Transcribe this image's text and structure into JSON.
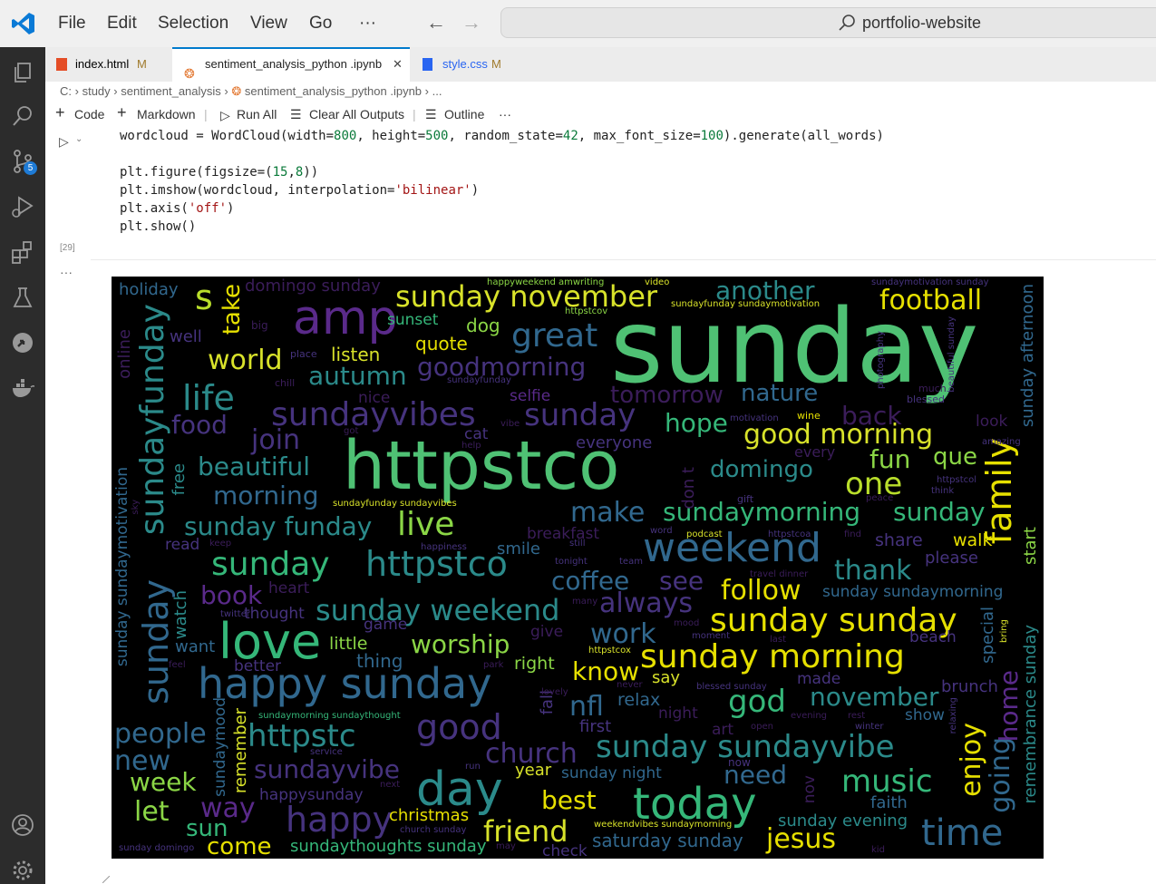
{
  "menu": {
    "file": "File",
    "edit": "Edit",
    "selection": "Selection",
    "view": "View",
    "go": "Go",
    "more": "···"
  },
  "search": {
    "text": "portfolio-website"
  },
  "activity": {
    "scm_badge": "5"
  },
  "tabs": [
    {
      "name": "index.html",
      "status": "M"
    },
    {
      "name": "sentiment_analysis_python .ipynb",
      "close": "✕"
    },
    {
      "name": "style.css",
      "status": "M"
    }
  ],
  "breadcrumb": {
    "drive": "C:",
    "folder1": "study",
    "folder2": "sentiment_analysis",
    "file": "sentiment_analysis_python .ipynb",
    "ellipsis": "..."
  },
  "toolbar": {
    "code": "Code",
    "markdown": "Markdown",
    "run_all": "Run All",
    "clear": "Clear All Outputs",
    "outline": "Outline",
    "more": "···"
  },
  "cell": {
    "exec_count": "[29]",
    "line1_a": "wordcloud = WordCloud(width=",
    "line1_n1": "800",
    "line1_b": ", height=",
    "line1_n2": "500",
    "line1_c": ", random_state=",
    "line1_n3": "42",
    "line1_d": ", max_font_size=",
    "line1_n4": "100",
    "line1_e": ").generate(all_words)",
    "line2_a": "plt.figure(figsize=(",
    "line2_n1": "15",
    "line2_b": ",",
    "line2_n2": "8",
    "line2_c": "))",
    "line3_a": "plt.imshow(wordcloud, interpolation=",
    "line3_s": "'bilinear'",
    "line3_b": ")",
    "line4_a": "plt.axis(",
    "line4_s": "'off'",
    "line4_b": ")",
    "line5": "plt.show()",
    "output_dots": "···"
  },
  "colors": {
    "accent": "#007acc",
    "wordcloud_bg": "#000000",
    "purple": "#3b1d5a",
    "teal": "#2b8a8a",
    "green": "#4fc174",
    "yellow": "#e6e000"
  },
  "wordcloud": {
    "w1": "sunday",
    "w2": "httpstco",
    "w3": "amp",
    "w4": "sunday november",
    "w5": "another",
    "w6": "football",
    "w7": "s",
    "w8": "take",
    "w9": "domingo sunday",
    "w10": "holiday",
    "w11": "sunset",
    "w12": "dog",
    "w13": "great",
    "w14": "quote",
    "w15": "world",
    "w16": "listen",
    "w17": "autumn",
    "w18": "goodmorning",
    "w19": "life",
    "w20": "sundayvibes",
    "w21": "sunday",
    "w22": "tomorrow",
    "w23": "nature",
    "w24": "food",
    "w25": "join",
    "w26": "hope",
    "w27": "back",
    "w28": "good morning",
    "w29": "look",
    "w30": "beautiful",
    "w31": "everyone",
    "w32": "domingo",
    "w33": "fun",
    "w34": "que",
    "w35": "one",
    "w36": "morning",
    "w37": "make",
    "w38": "sundaymorning",
    "w39": "sunday",
    "w40": "sunday funday",
    "w41": "live",
    "w42": "weekend",
    "w43": "share",
    "w44": "walk",
    "w45": "sunday",
    "w46": "httpstco",
    "w47": "coffee",
    "w48": "see",
    "w49": "thank",
    "w50": "please",
    "w51": "book",
    "w52": "follow",
    "w53": "sunday weekend",
    "w54": "always",
    "w55": "sunday sunday",
    "w56": "love",
    "w57": "work",
    "w58": "worship",
    "w59": "little",
    "w60": "beach",
    "w61": "sunday morning",
    "w62": "thing",
    "w63": "right",
    "w64": "know",
    "w65": "say",
    "w66": "made",
    "w67": "happy sunday",
    "w68": "god",
    "w69": "november",
    "w70": "nfl",
    "w71": "relax",
    "w72": "brunch",
    "w73": "people",
    "w74": "good",
    "w75": "httpstc",
    "w76": "first",
    "w77": "show",
    "w78": "church",
    "w79": "sunday sundayvibe",
    "w80": "new",
    "w81": "sundayvibe",
    "w82": "year",
    "w83": "sunday night",
    "w84": "need",
    "w85": "music",
    "w86": "week",
    "w87": "day",
    "w88": "today",
    "w89": "faith",
    "w90": "best",
    "w91": "let",
    "w92": "way",
    "w93": "happy",
    "w94": "christmas",
    "w95": "sun",
    "w96": "friend",
    "w97": "time",
    "w98": "sunday evening",
    "w99": "jesus",
    "w100": "come",
    "w101": "sundaythoughts sunday",
    "w102": "check",
    "w103": "saturday sunday",
    "w104": "family",
    "w105": "sundayfunday",
    "w106": "sunday",
    "w107": "sunday sundaymotivation",
    "w108": "enjoy",
    "w109": "going",
    "w110": "home",
    "w111": "remembrance sunday",
    "w112": "sunday afternoon",
    "w113": "start",
    "w114": "watch",
    "w115": "free",
    "w116": "online",
    "w117": "remember",
    "w118": "sundaymood",
    "w119": "special",
    "w120": "fall",
    "w121": "don t",
    "w122": "well",
    "w123": "read",
    "w124": "smile",
    "w125": "better",
    "w126": "want",
    "w127": "thought",
    "w128": "heart",
    "w129": "game",
    "w130": "give",
    "w131": "cat",
    "w132": "nice",
    "w133": "selfie",
    "w134": "every",
    "w135": "art",
    "w136": "night",
    "w137": "breakfast",
    "w138": "happysunday",
    "w139": "big",
    "w140": "chill",
    "w141": "place",
    "w142": "photography",
    "w143": "beautiful sunday",
    "w144": "much",
    "w145": "blessed",
    "w146": "wine",
    "w147": "amazing",
    "w148": "httpstcol",
    "w149": "think",
    "w150": "gift",
    "w151": "peace",
    "w152": "podcast",
    "w153": "httpstcoa",
    "w154": "word",
    "w155": "find",
    "w156": "still",
    "w157": "happiness",
    "w158": "tonight",
    "w159": "team",
    "w160": "travel dinner",
    "w161": "sunday sundaymorning",
    "w162": "many",
    "w163": "mood",
    "w164": "last",
    "w165": "twitter",
    "w166": "feel",
    "w167": "park",
    "w168": "lovely",
    "w169": "never",
    "w170": "blessed sunday",
    "w171": "evening",
    "w172": "rest",
    "w173": "winter",
    "w174": "open",
    "w175": "now",
    "w176": "run",
    "w177": "service",
    "w178": "next",
    "w179": "church sunday",
    "w180": "may",
    "w181": "weekendvibes sundaymorning",
    "w182": "kid",
    "w183": "sunday domingo",
    "w184": "sundaymorning sundaythought",
    "w185": "sundayfunday sundayvibes",
    "w186": "moment",
    "w187": "happyweekend amwriting",
    "w188": "video",
    "w189": "httpstcov",
    "w190": "sundayfunday sundaymotivation",
    "w191": "sundaymotivation sunday",
    "w192": "sundayfunday",
    "w193": "motivation",
    "w194": "vibe",
    "w195": "got",
    "w196": "help",
    "w197": "keep",
    "w198": "sky",
    "w199": "httpstcox",
    "w200": "nov",
    "w201": "bring",
    "w202": "relaxing"
  }
}
